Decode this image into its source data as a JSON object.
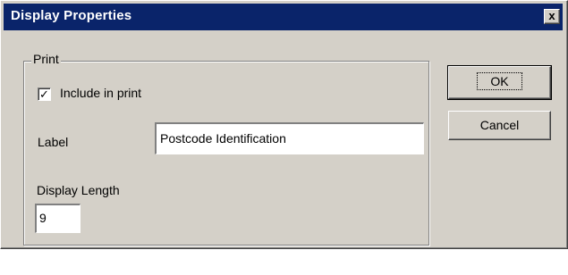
{
  "window": {
    "title": "Display Properties",
    "close_glyph": "x"
  },
  "print_group": {
    "legend": "Print",
    "include_checked": true,
    "include_label": "Include in print",
    "label_caption": "Label",
    "label_value": "Postcode Identification",
    "length_caption": "Display Length",
    "length_value": "9"
  },
  "buttons": {
    "ok": "OK",
    "cancel": "Cancel"
  },
  "colors": {
    "title_bar": "#0a246a",
    "face": "#d4d0c8"
  }
}
